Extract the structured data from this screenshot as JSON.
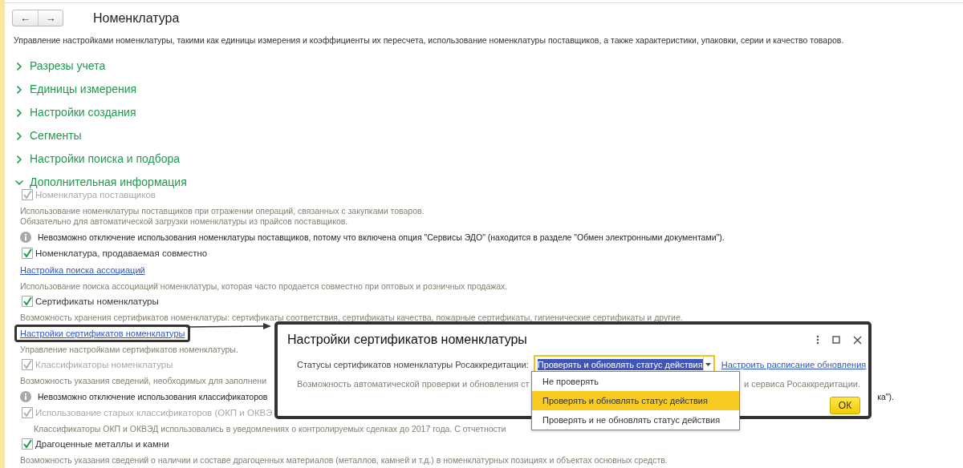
{
  "window": {
    "title": "Номенклатура"
  },
  "nav": {
    "back": "←",
    "forward": "→"
  },
  "description": "Управление настройками номенклатуры, такими как единицы измерения и коэффициенты их пересчета, использование номенклатуры поставщиков, а также характеристики, упаковки, серии и качество товаров.",
  "sections": [
    {
      "label": "Разрезы учета",
      "expanded": false
    },
    {
      "label": "Единицы измерения",
      "expanded": false
    },
    {
      "label": "Настройки создания",
      "expanded": false
    },
    {
      "label": "Сегменты",
      "expanded": false
    },
    {
      "label": "Настройки поиска и подбора",
      "expanded": false
    },
    {
      "label": "Дополнительная информация",
      "expanded": true
    }
  ],
  "additional_info": [
    {
      "kind": "checkbox",
      "label": "Номенклатура поставщиков",
      "checked": true,
      "disabled": true
    },
    {
      "kind": "note",
      "lines": [
        "Использование номенклатуры поставщиков при отражении операций, связанных с закупками товаров.",
        "Обязательно для автоматической загрузки номенклатуры из прайсов поставщиков."
      ]
    },
    {
      "kind": "info",
      "text": "Невозможно отключение использования номенклатуры поставщиков, потому что включена опция \"Сервисы ЭДО\" (находится в разделе \"Обмен электронными документами\")."
    },
    {
      "kind": "checkbox",
      "label": "Номенклатура, продаваемая совместно",
      "checked": true,
      "disabled": false
    },
    {
      "kind": "link",
      "label": "Настройка поиска ассоциаций",
      "framed": false
    },
    {
      "kind": "note",
      "lines": [
        "Использование поиска ассоциаций номенклатуры, которая часто продается совместно при оптовых и розничных продажах."
      ]
    },
    {
      "kind": "checkbox",
      "label": "Сертификаты номенклатуры",
      "checked": true,
      "disabled": false
    },
    {
      "kind": "note",
      "lines": [
        "Возможность хранения сертификатов номенклатуры: сертификаты соответствия, сертификаты качества, пожарные сертификаты, гигиенические сертификаты и другие."
      ]
    },
    {
      "kind": "link",
      "label": "Настройки сертификатов номенклатуры",
      "framed": true
    },
    {
      "kind": "note",
      "lines": [
        "Управление настройками сертификатов номенклатуры."
      ]
    },
    {
      "kind": "checkbox",
      "label": "Классификаторы номенклатуры",
      "checked": true,
      "disabled": true
    },
    {
      "kind": "note",
      "lines": [
        "Возможность указания сведений, необходимых для заполнени"
      ]
    },
    {
      "kind": "info",
      "text": "Невозможно отключение использования классификаторов",
      "tail": "ка\")."
    },
    {
      "kind": "checkbox",
      "label": "Использование старых классификаторов (ОКП и ОКВЭ",
      "checked": true,
      "disabled": true,
      "children": [
        {
          "kind": "note",
          "lines": [
            "Классификаторы ОКП и ОКВЭД использовались в уведомлениях о контролируемых сделках до 2017 года. С отчетности"
          ]
        }
      ]
    },
    {
      "kind": "checkbox",
      "label": "Драгоценные металлы и камни",
      "checked": true,
      "disabled": false
    },
    {
      "kind": "note",
      "lines": [
        "Возможность указания сведений о наличии и составе драгоценных материалов (металлов, камней и т.д.) в номенклатурных позициях и объектах основных средств."
      ]
    }
  ],
  "dialog": {
    "title": "Настройки сертификатов номенклатуры",
    "field_label": "Статусы сертификатов номенклатуры Росаккредитации:",
    "field_value": "Проверять и обновлять статус действия",
    "schedule_link": "Настроить расписание обновления",
    "note_start": "Возможность автоматической проверки и обновления ст",
    "note_end": "и сервиса Росаккредитации.",
    "ok": "ОК",
    "options": [
      {
        "label": "Не проверять",
        "selected": false
      },
      {
        "label": "Проверять и обновлять статус действия",
        "selected": true
      },
      {
        "label": "Проверять и не обновлять статус действия",
        "selected": false
      }
    ]
  }
}
